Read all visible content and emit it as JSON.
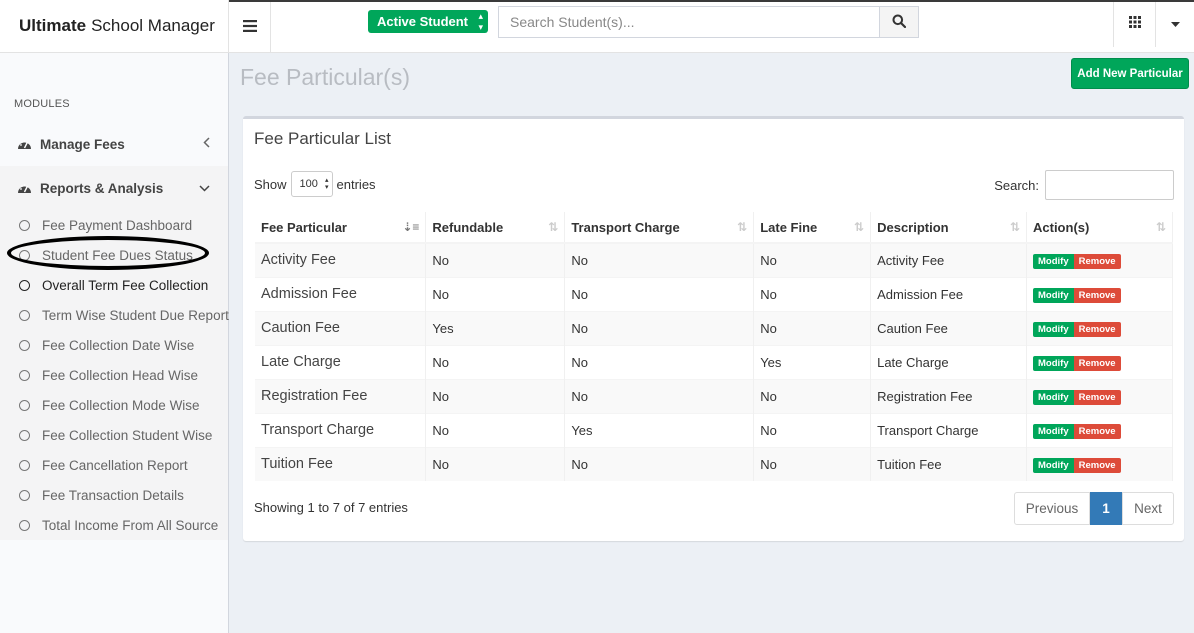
{
  "app": {
    "title_bold": "Ultimate",
    "title_rest": "School Manager"
  },
  "header": {
    "status_select": "Active Student",
    "search_placeholder": "Search Student(s)..."
  },
  "sidebar": {
    "modules_label": "MODULES",
    "menu1": "Manage Fees",
    "menu2": "Reports & Analysis",
    "items": [
      "Fee Payment Dashboard",
      "Student Fee Dues Status",
      "Overall Term Fee Collection",
      "Term Wise Student Due Report",
      "Fee Collection Date Wise",
      "Fee Collection Head Wise",
      "Fee Collection Mode Wise",
      "Fee Collection Student Wise",
      "Fee Cancellation Report",
      "Fee Transaction Details",
      "Total Income From All Source"
    ]
  },
  "page": {
    "title": "Fee Particular(s)",
    "add_button": "Add New Particular",
    "box_title": "Fee Particular List",
    "show_label": "Show",
    "entries_value": "100",
    "entries_label": "entries",
    "search_label": "Search:",
    "info": "Showing 1 to 7 of 7 entries",
    "prev": "Previous",
    "page_num": "1",
    "next": "Next",
    "modify": "Modify",
    "remove": "Remove"
  },
  "table": {
    "columns": [
      "Fee Particular",
      "Refundable",
      "Transport Charge",
      "Late Fine",
      "Description",
      "Action(s)"
    ],
    "rows": [
      [
        "Activity Fee",
        "No",
        "No",
        "No",
        "Activity Fee"
      ],
      [
        "Admission Fee",
        "No",
        "No",
        "No",
        "Admission Fee"
      ],
      [
        "Caution Fee",
        "Yes",
        "No",
        "No",
        "Caution Fee"
      ],
      [
        "Late Charge",
        "No",
        "No",
        "Yes",
        "Late Charge"
      ],
      [
        "Registration Fee",
        "No",
        "No",
        "No",
        "Registration Fee"
      ],
      [
        "Transport Charge",
        "No",
        "Yes",
        "No",
        "Transport Charge"
      ],
      [
        "Tuition Fee",
        "No",
        "No",
        "No",
        "Tuition Fee"
      ]
    ]
  }
}
